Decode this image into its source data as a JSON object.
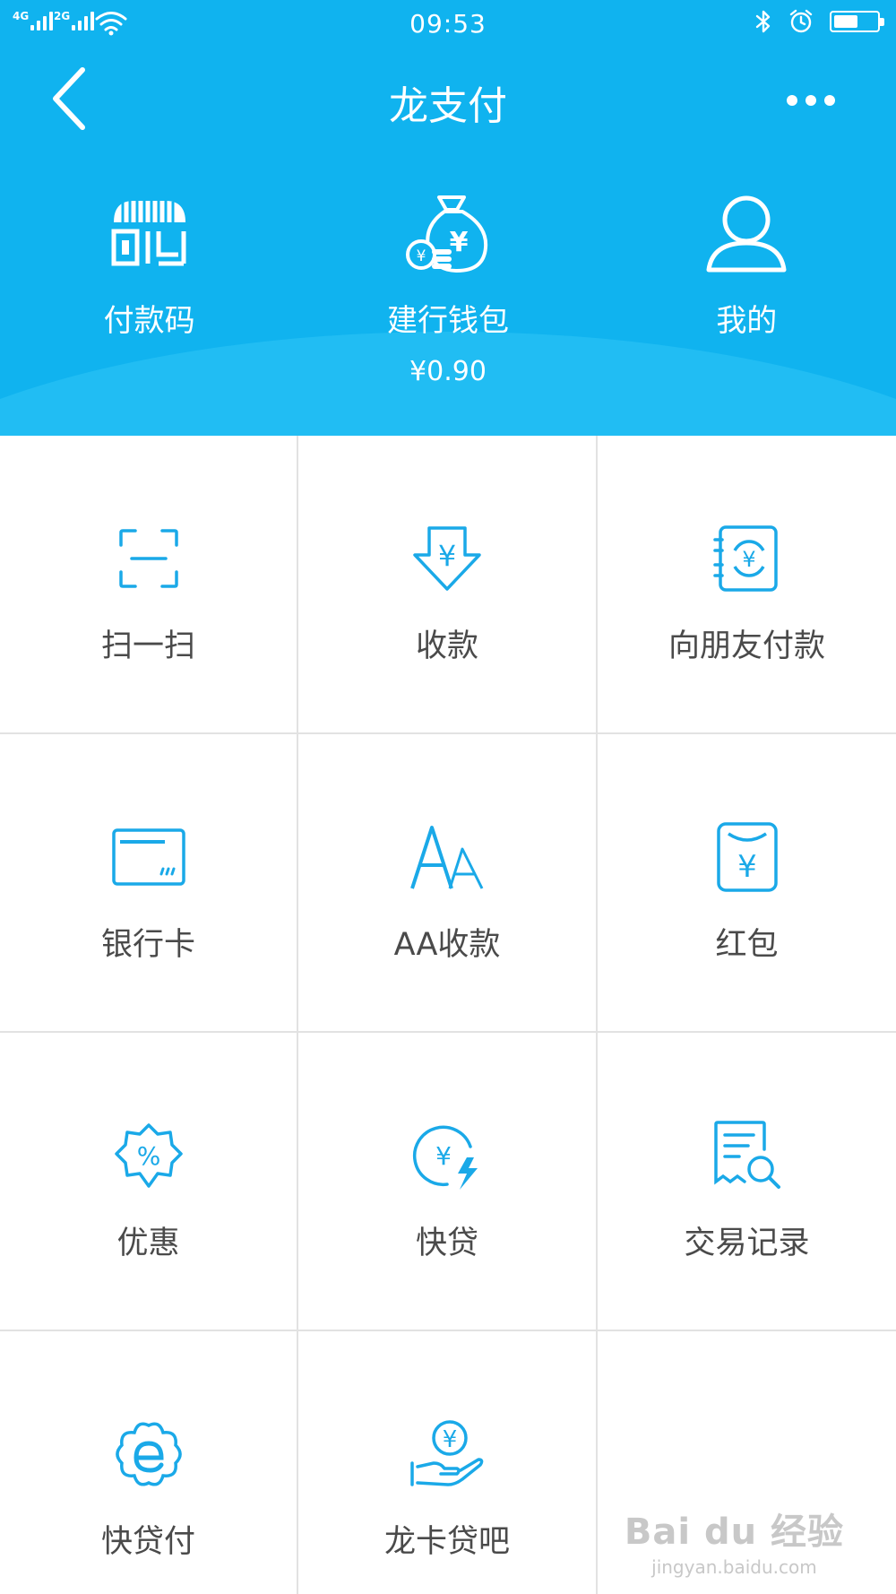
{
  "status_bar": {
    "net_1": "4G",
    "net_2": "2G",
    "time": "09:53",
    "battery_level": 0.55
  },
  "nav": {
    "title": "龙支付"
  },
  "top_actions": [
    {
      "label": "付款码",
      "icon": "payment-code-icon"
    },
    {
      "label": "建行钱包",
      "sub": "¥0.90",
      "icon": "money-bag-icon"
    },
    {
      "label": "我的",
      "icon": "user-icon"
    }
  ],
  "grid": [
    {
      "label": "扫一扫",
      "icon": "scan-icon"
    },
    {
      "label": "收款",
      "icon": "receive-money-icon"
    },
    {
      "label": "向朋友付款",
      "icon": "pay-friend-icon"
    },
    {
      "label": "银行卡",
      "icon": "bank-card-icon"
    },
    {
      "label": "AA收款",
      "icon": "aa-icon"
    },
    {
      "label": "红包",
      "icon": "red-packet-icon"
    },
    {
      "label": "优惠",
      "icon": "discount-icon"
    },
    {
      "label": "快贷",
      "icon": "quick-loan-icon"
    },
    {
      "label": "交易记录",
      "icon": "transaction-record-icon"
    },
    {
      "label": "快贷付",
      "icon": "quick-loan-pay-icon"
    },
    {
      "label": "龙卡贷吧",
      "icon": "loan-hand-icon"
    }
  ],
  "watermark": {
    "main": "Bai du 经验",
    "sub": "jingyan.baidu.com"
  },
  "colors": {
    "header_blue": "#10b3ef",
    "icon_blue": "#1aa9e8",
    "text_gray": "#4a4a4a"
  }
}
